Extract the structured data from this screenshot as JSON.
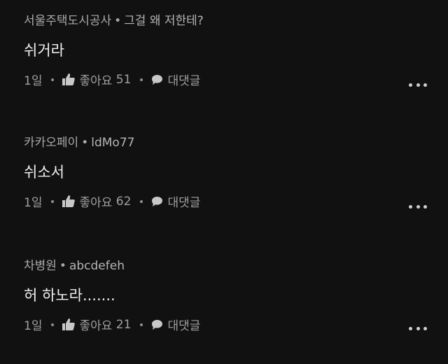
{
  "comments": [
    {
      "author": "서울주택도시공사",
      "handle": "그걸 왜 저한테?",
      "text": "쉬거라",
      "time": "1일",
      "like_label": "좋아요",
      "like_count": "51",
      "reply_label": "대댓글"
    },
    {
      "author": "카카오페이",
      "handle": "ldMo77",
      "text": "쉬소서",
      "time": "1일",
      "like_label": "좋아요",
      "like_count": "62",
      "reply_label": "대댓글"
    },
    {
      "author": "차병원",
      "handle": "abcdefeh",
      "text": "허 하노라.......",
      "time": "1일",
      "like_label": "좋아요",
      "like_count": "21",
      "reply_label": "대댓글"
    }
  ],
  "separator": "•",
  "icons": {
    "like": "thumbs-up-icon",
    "reply": "speech-bubble-icon",
    "more": "more-horizontal-icon"
  },
  "colors": {
    "background": "#111111",
    "text": "#f0f0f0",
    "meta": "#a9a9a9"
  }
}
